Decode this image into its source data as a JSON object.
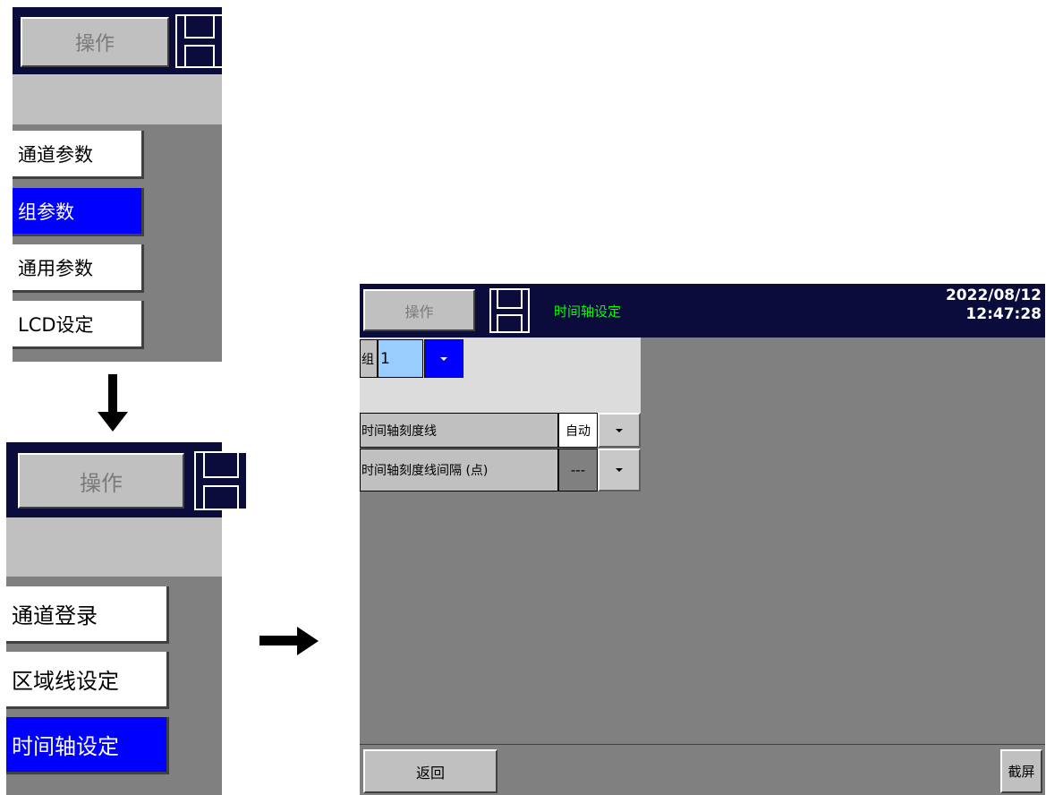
{
  "left_top": {
    "operate_label": "操作",
    "menu": [
      {
        "label": "通道参数",
        "selected": false
      },
      {
        "label": "组参数",
        "selected": true
      },
      {
        "label": "通用参数",
        "selected": false
      },
      {
        "label": "LCD设定",
        "selected": false
      }
    ]
  },
  "left_bottom": {
    "operate_label": "操作",
    "menu": [
      {
        "label": "通道登录",
        "selected": false
      },
      {
        "label": "区域线设定",
        "selected": false
      },
      {
        "label": "时间轴设定",
        "selected": true
      }
    ]
  },
  "screen": {
    "operate_label": "操作",
    "title": "时间轴设定",
    "date": "2022/08/12",
    "time": "12:47:28",
    "group_label": "组",
    "group_value": "1",
    "rows": [
      {
        "label": "时间轴刻度线",
        "value": "自动"
      },
      {
        "label": "时间轴刻度线间隔 (点)",
        "value": "---"
      }
    ],
    "back_label": "返回",
    "screenshot_label": "截屏"
  },
  "colors": {
    "navy": "#0b0b3c",
    "selected_blue": "#0000ff",
    "title_green": "#00ff00",
    "group_value_bg": "#99ccff"
  },
  "icons": [
    "floppy-disk-icon",
    "arrow-down-icon",
    "arrow-right-icon",
    "dropdown-caret-icon"
  ]
}
